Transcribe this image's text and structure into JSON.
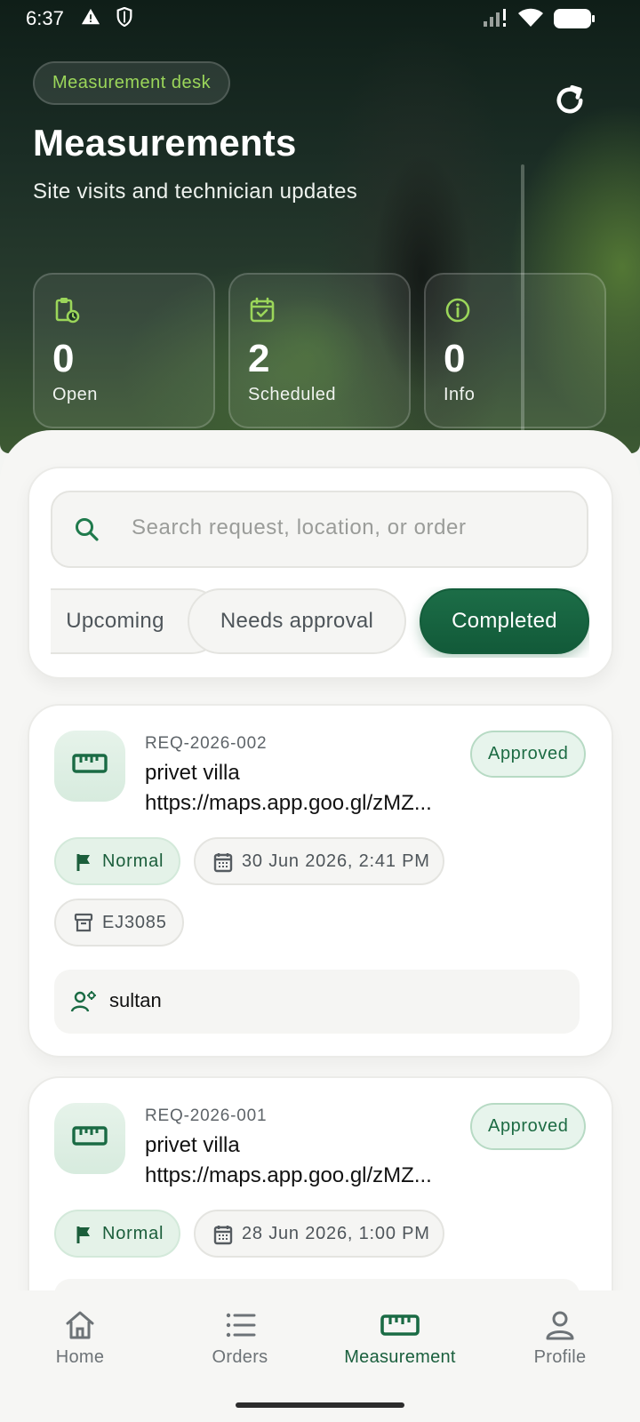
{
  "status_bar": {
    "time": "6:37"
  },
  "header": {
    "badge": "Measurement desk",
    "title": "Measurements",
    "subtitle": "Site visits and technician updates"
  },
  "stats": [
    {
      "value": "0",
      "label": "Open",
      "icon": "clipboard-clock-icon"
    },
    {
      "value": "2",
      "label": "Scheduled",
      "icon": "calendar-check-icon"
    },
    {
      "value": "0",
      "label": "Info",
      "icon": "info-icon"
    }
  ],
  "search": {
    "placeholder": "Search request, location, or order"
  },
  "filters": [
    {
      "label": "Upcoming",
      "active": false
    },
    {
      "label": "Needs approval",
      "active": false
    },
    {
      "label": "Completed",
      "active": true
    }
  ],
  "requests": [
    {
      "id": "REQ-2026-002",
      "title": "privet villa",
      "link": "https://maps.app.goo.gl/zMZ...",
      "status": "Approved",
      "priority": "Normal",
      "datetime": "30 Jun 2026, 2:41 PM",
      "order": "EJ3085",
      "assignee": "sultan"
    },
    {
      "id": "REQ-2026-001",
      "title": "privet villa",
      "link": "https://maps.app.goo.gl/zMZ...",
      "status": "Approved",
      "priority": "Normal",
      "datetime": "28 Jun 2026, 1:00 PM"
    }
  ],
  "nav": [
    {
      "label": "Home",
      "icon": "home-icon",
      "active": false
    },
    {
      "label": "Orders",
      "icon": "list-icon",
      "active": false
    },
    {
      "label": "Measurement",
      "icon": "ruler-icon",
      "active": true
    },
    {
      "label": "Profile",
      "icon": "person-icon",
      "active": false
    }
  ],
  "colors": {
    "accent": "#1a6b44",
    "badge_text": "#9bd65a",
    "stat_icon": "#9bd65a"
  }
}
